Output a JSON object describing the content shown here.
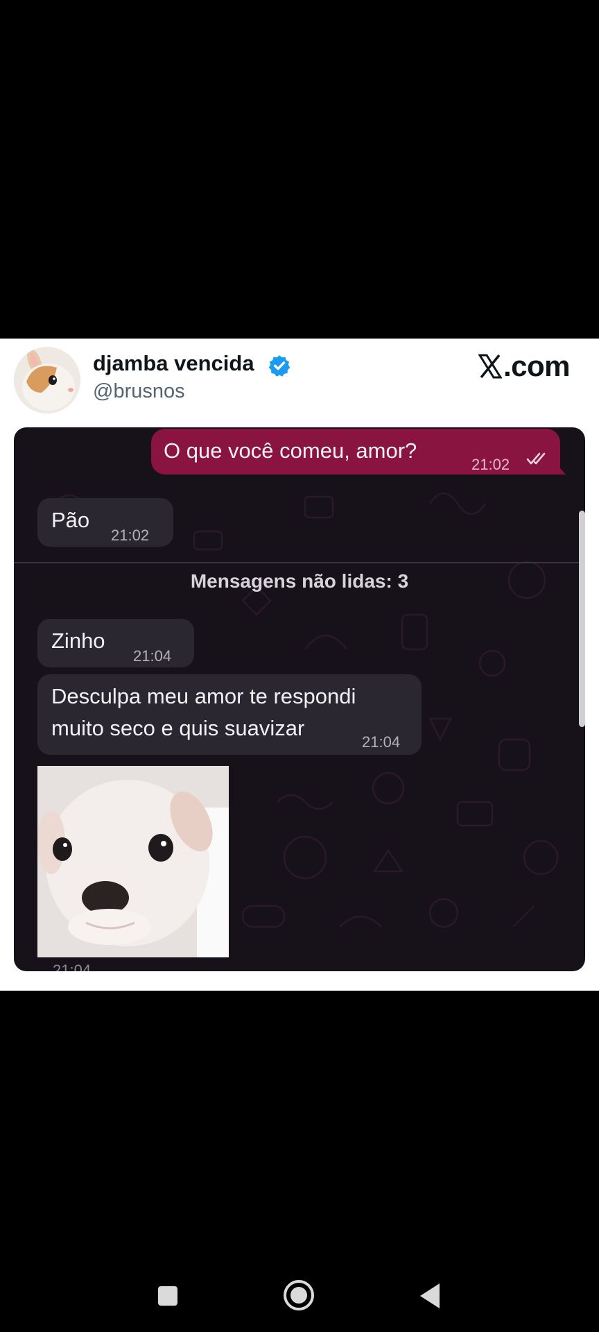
{
  "post": {
    "author_name": "djamba vencida",
    "handle": "@brusnos",
    "source": ".com",
    "avatar_icon": "bunny-avatar-icon",
    "verified_icon": "verified-badge-icon",
    "verified_color": "#1d9bf0"
  },
  "chat": {
    "background_color": "#17121a",
    "outgoing_color": "#8a1440",
    "incoming_color": "#2b2730",
    "messages": [
      {
        "direction": "out",
        "text": "O que você comeu, amor?",
        "time": "21:02",
        "status_icon": "double-check-icon"
      },
      {
        "direction": "in",
        "text": "Pão",
        "time": "21:02"
      },
      {
        "direction": "in",
        "text": "Zinho",
        "time": "21:04"
      },
      {
        "direction": "in",
        "text_lines": [
          "Desculpa meu amor te respondi",
          "muito seco e quis suavizar"
        ],
        "time": "21:04"
      },
      {
        "direction": "in",
        "type": "sticker",
        "icon": "puppy-sticker-icon",
        "time": "21:04"
      }
    ],
    "unread_label": "Mensagens não lidas: 3"
  },
  "nav": {
    "recents_icon": "square-recents-icon",
    "home_icon": "circle-home-icon",
    "back_icon": "triangle-back-icon"
  }
}
